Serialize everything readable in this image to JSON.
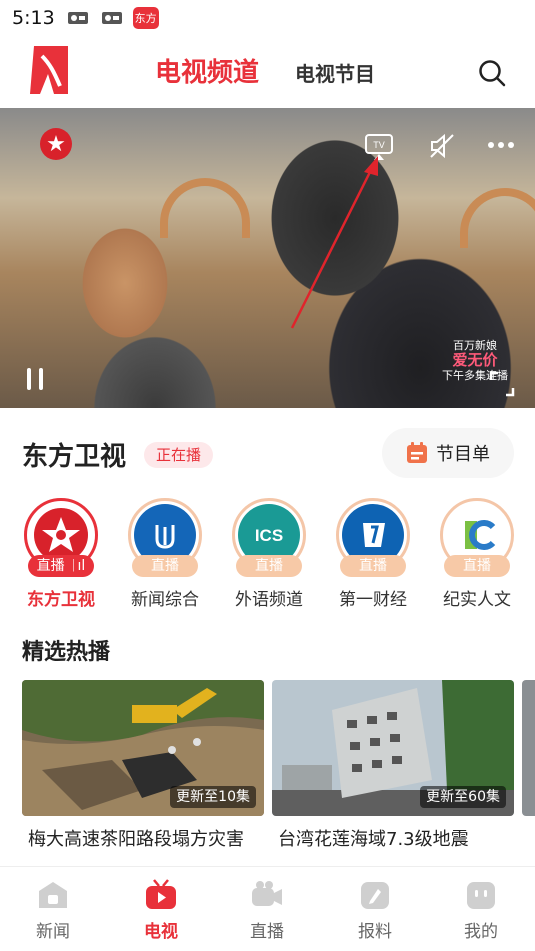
{
  "status_bar": {
    "time": "5:13",
    "app_badge": "东方"
  },
  "header": {
    "tabs": [
      {
        "label": "电视频道",
        "active": true
      },
      {
        "label": "电视节目",
        "active": false
      }
    ]
  },
  "player": {
    "watermark_line1": "百万新娘",
    "watermark_line2": "爱无价",
    "watermark_line3": "下午多集连播",
    "channel_logo_text": "★"
  },
  "current_channel": {
    "name": "东方卫视",
    "live_label": "正在播",
    "schedule_label": "节目单"
  },
  "channels": [
    {
      "label": "东方卫视",
      "tag": "直播",
      "active": true,
      "color": "#e8313a"
    },
    {
      "label": "新闻综合",
      "tag": "直播",
      "active": false,
      "color": "#1466b8"
    },
    {
      "label": "外语频道",
      "tag": "直播",
      "active": false,
      "color": "#1a9a95"
    },
    {
      "label": "第一财经",
      "tag": "直播",
      "active": false,
      "color": "#0e63b3"
    },
    {
      "label": "纪实人文",
      "tag": "直播",
      "active": false,
      "color": "#ffffff"
    }
  ],
  "featured": {
    "title": "精选热播",
    "items": [
      {
        "title": "梅大高速茶阳路段塌方灾害",
        "episodes": "更新至10集"
      },
      {
        "title": "台湾花莲海域7.3级地震",
        "episodes": "更新至60集"
      }
    ]
  },
  "bottom_nav": [
    {
      "label": "新闻",
      "active": false
    },
    {
      "label": "电视",
      "active": true
    },
    {
      "label": "直播",
      "active": false
    },
    {
      "label": "报料",
      "active": false
    },
    {
      "label": "我的",
      "active": false
    }
  ],
  "colors": {
    "accent": "#e8313a",
    "tag_inactive": "#f7c9a7"
  }
}
